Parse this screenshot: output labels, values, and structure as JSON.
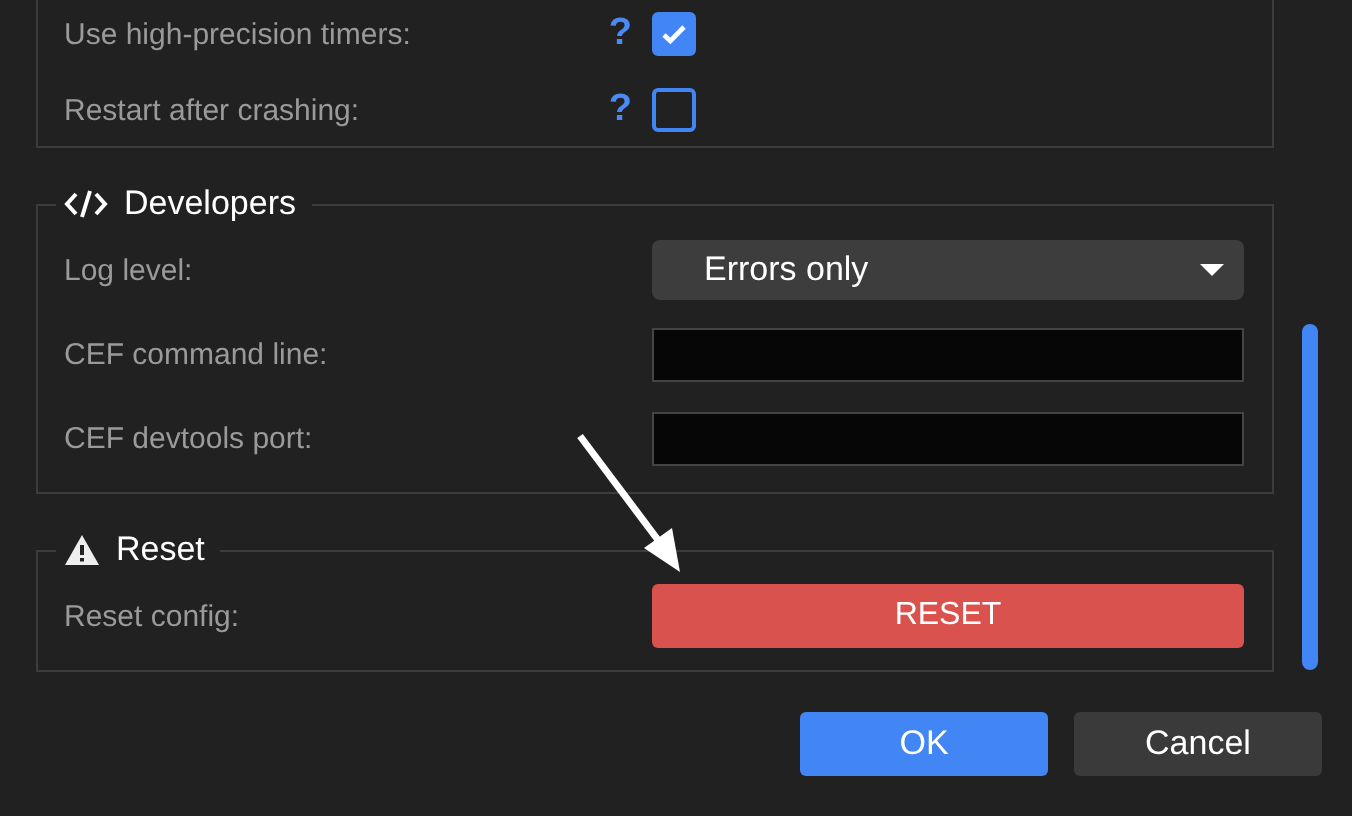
{
  "sections": [
    {
      "kind": "checks",
      "rows": [
        {
          "label": "Use high-precision timers:",
          "help": "?",
          "checked": true
        },
        {
          "label": "Restart after crashing:",
          "help": "?",
          "checked": false
        }
      ]
    },
    {
      "kind": "fields",
      "title": "Developers",
      "rows": [
        {
          "kind": "select",
          "label": "Log level:",
          "value": "Errors only"
        },
        {
          "kind": "text",
          "label": "CEF command line:"
        },
        {
          "kind": "text",
          "label": "CEF devtools port:"
        }
      ]
    },
    {
      "kind": "danger",
      "title": "Reset",
      "rows": [
        {
          "kind": "button",
          "label": "Reset config:",
          "button": "RESET"
        }
      ]
    }
  ],
  "buttons": [
    {
      "kind": "primary",
      "label": "OK"
    },
    {
      "kind": "secondary",
      "label": "Cancel"
    }
  ]
}
